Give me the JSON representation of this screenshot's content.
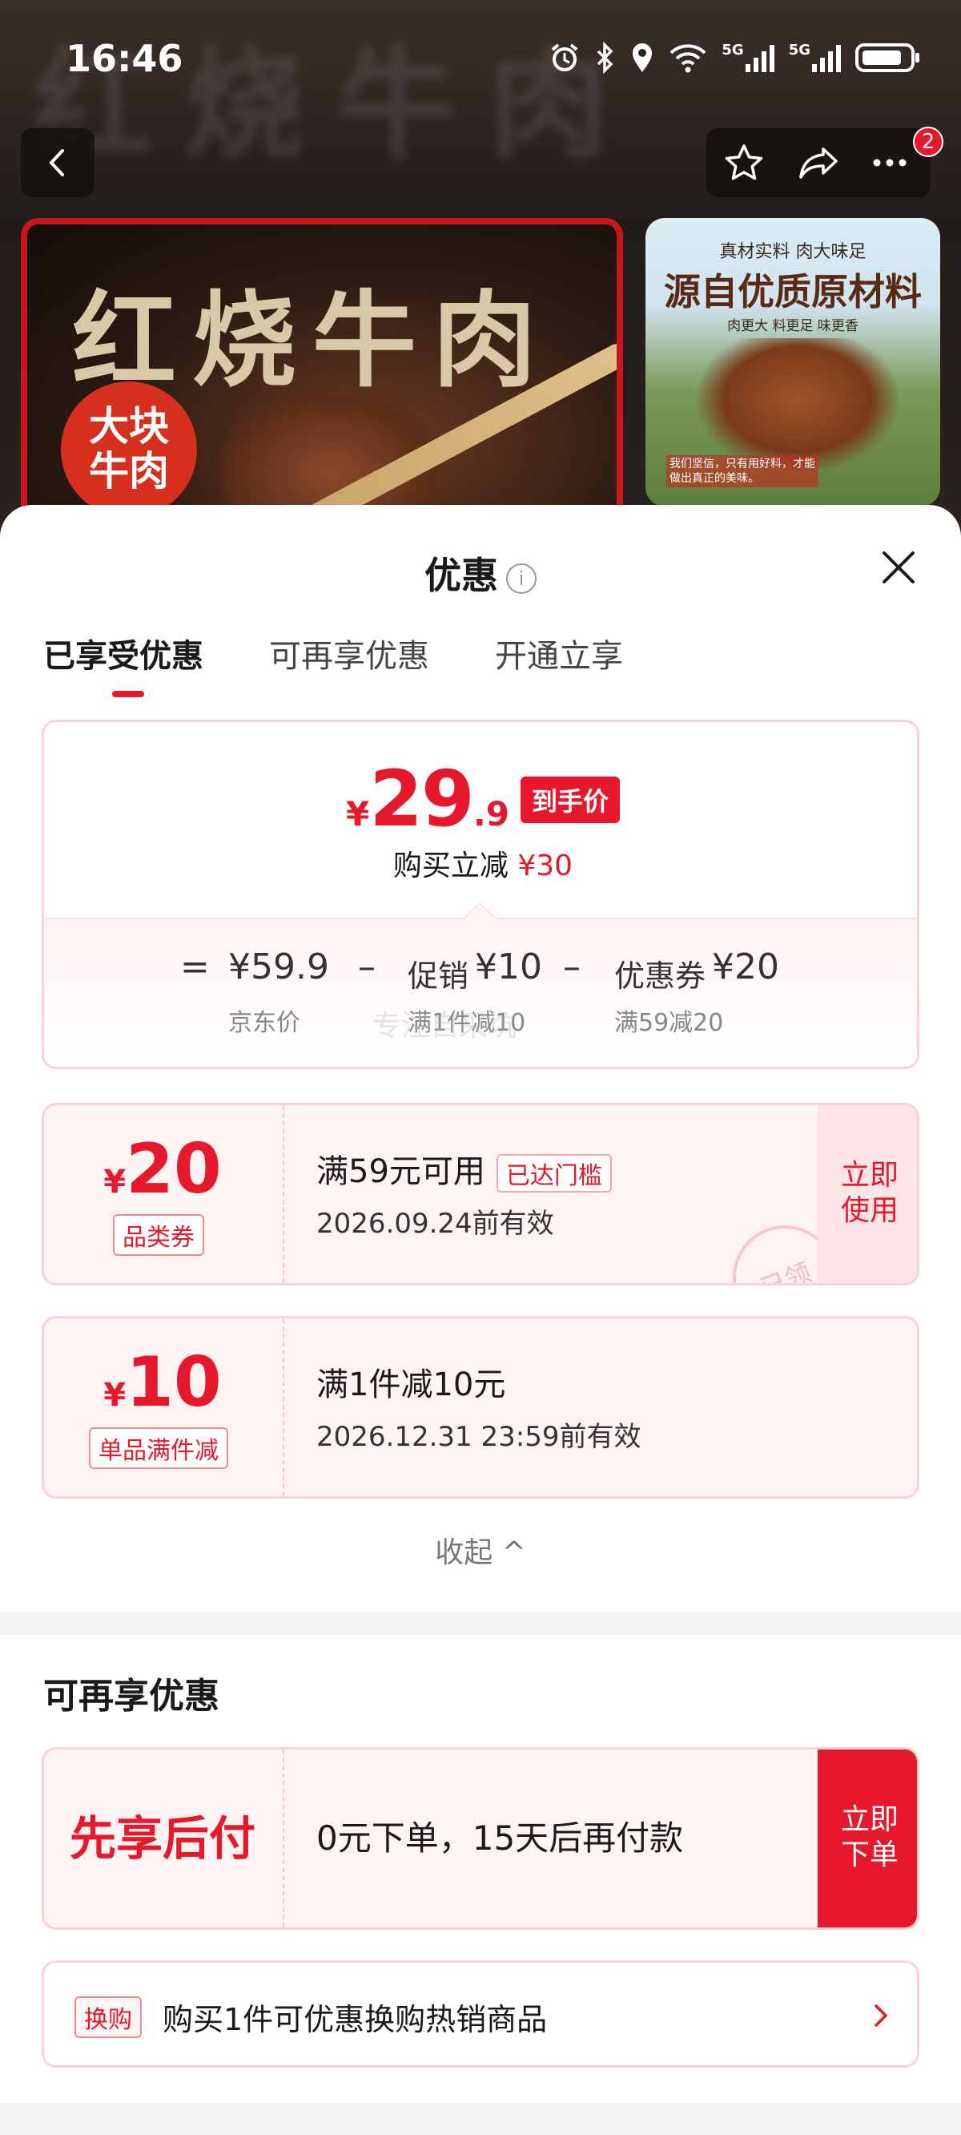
{
  "status_bar": {
    "time": "16:46",
    "network1": "5G",
    "network2": "5G"
  },
  "top_nav": {
    "cart_badge": "2"
  },
  "banner_main": {
    "title": "红烧牛肉",
    "seal": "大块牛肉"
  },
  "banner_side": {
    "slogan": "真材实料 肉大味足",
    "headline": "源自优质原材料",
    "features": "肉更大 料更足 味更香",
    "note": "我们坚信，只有用好料，才能做出真正的美味。"
  },
  "sheet": {
    "title": "优惠",
    "info_icon": "i",
    "tabs": [
      "已享受优惠",
      "可再享优惠",
      "开通立享"
    ],
    "price": {
      "currency": "¥",
      "integer": "29",
      "decimal": ".9",
      "tag": "到手价",
      "saving_prefix": "购买立减",
      "saving_value": "¥30"
    },
    "breakdown": {
      "eq": "=",
      "jd_price": "¥59.9",
      "jd_label": "京东价",
      "minus": "–",
      "promo_label": "促销",
      "promo_value": "¥10",
      "promo_desc": "满1件减10",
      "coupon_label": "优惠券",
      "coupon_value": "¥20",
      "coupon_desc": "满59减20",
      "watermark": "专注自采坑"
    },
    "coupons": [
      {
        "currency": "¥",
        "amount": "20",
        "type": "品类券",
        "condition": "满59元可用",
        "status": "已达门槛",
        "expiry": "2026.09.24前有效",
        "action": "立即使用",
        "stamp": "已领"
      },
      {
        "currency": "¥",
        "amount": "10",
        "type": "单品满件减",
        "condition": "满1件减10元",
        "expiry": "2026.12.31 23:59前有效"
      }
    ],
    "collapse_label": "收起 ^",
    "more_section": {
      "title": "可再享优惠",
      "paylater": {
        "label": "先享后付",
        "desc": "0元下单，15天后再付款",
        "action": "立即下单"
      },
      "swap": {
        "tag": "换购",
        "desc": "购买1件可优惠换购热销商品"
      }
    }
  },
  "colors": {
    "accent": "#e8182c",
    "card_bg": "#fdf3f3",
    "border": "#f6d3d6"
  }
}
